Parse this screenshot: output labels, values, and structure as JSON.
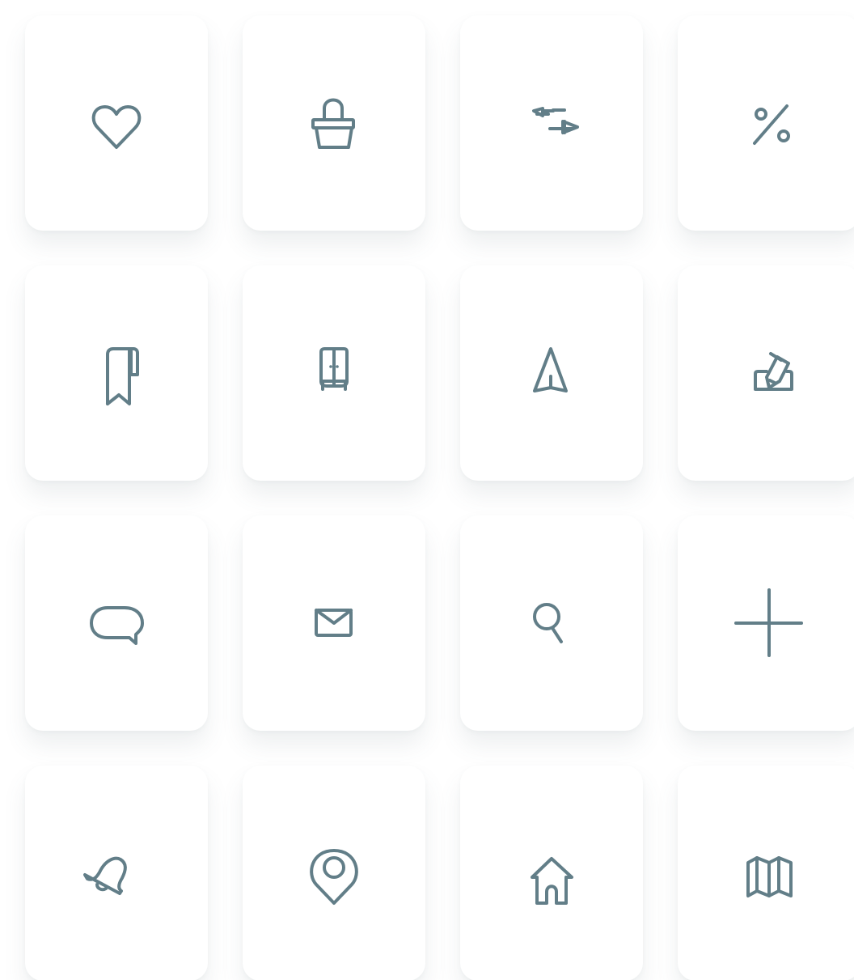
{
  "theme": {
    "icon_color": "#627e88",
    "tile_background": "#ffffff",
    "page_background": "#ffffff"
  },
  "icons": [
    {
      "name": "heart-icon"
    },
    {
      "name": "shopping-basket-icon"
    },
    {
      "name": "transfer-arrows-icon"
    },
    {
      "name": "percent-icon"
    },
    {
      "name": "bookmark-icon"
    },
    {
      "name": "wardrobe-icon"
    },
    {
      "name": "navigation-arrow-icon"
    },
    {
      "name": "edit-pencil-icon"
    },
    {
      "name": "chat-bubble-icon"
    },
    {
      "name": "mail-envelope-icon"
    },
    {
      "name": "search-icon"
    },
    {
      "name": "plus-icon"
    },
    {
      "name": "bell-icon"
    },
    {
      "name": "location-pin-icon"
    },
    {
      "name": "home-icon"
    },
    {
      "name": "map-icon"
    }
  ]
}
